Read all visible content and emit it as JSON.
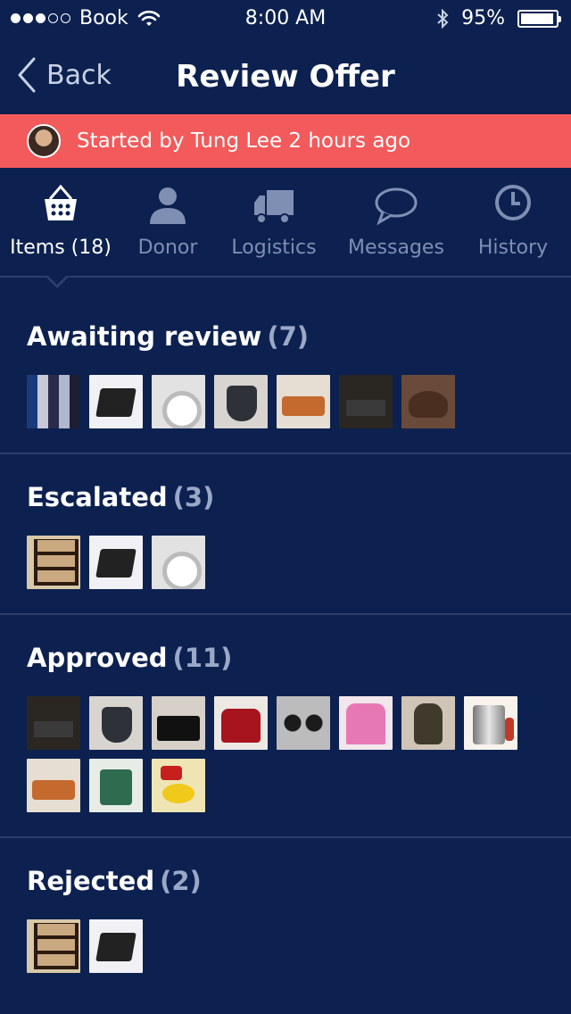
{
  "status_bar": {
    "carrier": "Book",
    "time": "8:00 AM",
    "battery": "95%",
    "signal_filled": 3,
    "signal_total": 5,
    "battery_level": 0.95
  },
  "nav": {
    "back_label": "Back",
    "title": "Review Offer"
  },
  "banner": {
    "text": "Started by Tung Lee 2 hours ago",
    "color": "#f25a5b"
  },
  "tabs": [
    {
      "label": "Items (18)",
      "icon": "basket-icon",
      "active": true
    },
    {
      "label": "Donor",
      "icon": "person-icon",
      "active": false
    },
    {
      "label": "Logistics",
      "icon": "truck-icon",
      "active": false
    },
    {
      "label": "Messages",
      "icon": "speech-bubble-icon",
      "active": false
    },
    {
      "label": "History",
      "icon": "clock-icon",
      "active": false
    }
  ],
  "sections": [
    {
      "title": "Awaiting review",
      "count": "(7)",
      "thumbs": [
        "books",
        "tray",
        "washer",
        "seat",
        "sofa",
        "desk",
        "shoes"
      ]
    },
    {
      "title": "Escalated",
      "count": "(3)",
      "thumbs": [
        "shelf",
        "tray",
        "washer"
      ]
    },
    {
      "title": "Approved",
      "count": "(11)",
      "thumbs": [
        "desk",
        "seat",
        "chanel",
        "redbag",
        "wheels",
        "pink",
        "backpack",
        "steel",
        "sofa",
        "scrubber",
        "grinder"
      ]
    },
    {
      "title": "Rejected",
      "count": "(2)",
      "thumbs": [
        "shelf",
        "tray"
      ]
    }
  ],
  "colors": {
    "background": "#0d2150",
    "accent_red": "#f25a5b",
    "muted_text": "#7f8fb3",
    "divider": "#2c3f6c"
  }
}
